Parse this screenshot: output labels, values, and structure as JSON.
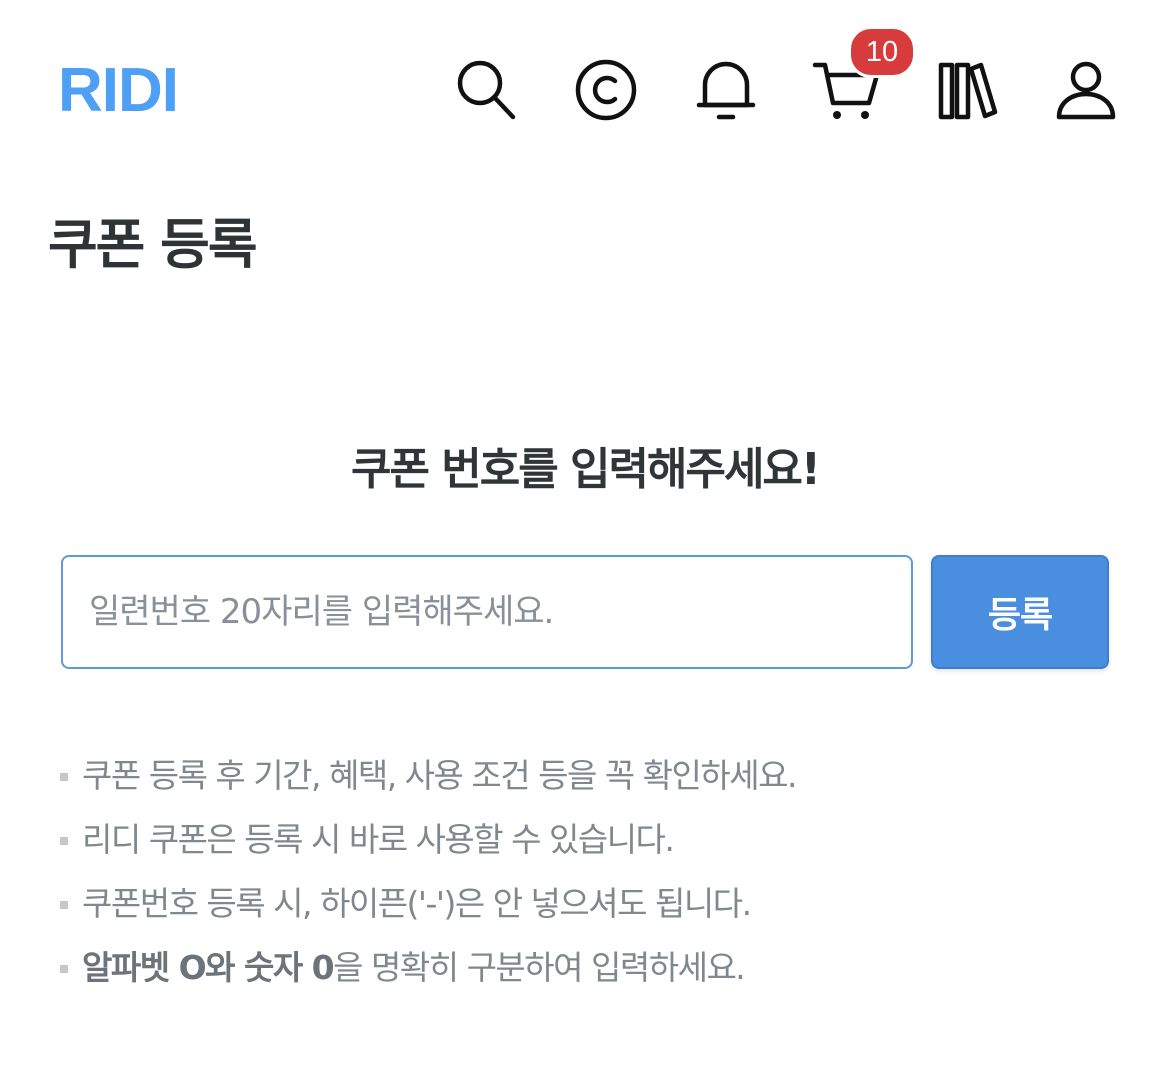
{
  "header": {
    "logo_text": "RIDI",
    "logo_color": "#4da0f6",
    "icons": [
      "search-icon",
      "cash-icon",
      "bell-icon",
      "cart-icon",
      "library-icon",
      "user-icon"
    ],
    "cart_badge": "10",
    "badge_color": "#d73b3b"
  },
  "page": {
    "title": "쿠폰 등록"
  },
  "coupon_form": {
    "heading": "쿠폰 번호를 입력해주세요!",
    "input_value": "",
    "input_placeholder": "일련번호 20자리를 입력해주세요.",
    "submit_label": "등록",
    "accent_color": "#4a8ee0"
  },
  "notes": {
    "item1": "쿠폰 등록 후 기간, 혜택, 사용 조건 등을 꼭 확인하세요.",
    "item2": "리디 쿠폰은 등록 시 바로 사용할 수 있습니다.",
    "item3": "쿠폰번호 등록 시, 하이픈('-')은 안 넣으셔도 됩니다.",
    "item4_bold": "알파벳 O와 숫자 0",
    "item4_rest": "을 명확히 구분하여 입력하세요."
  }
}
